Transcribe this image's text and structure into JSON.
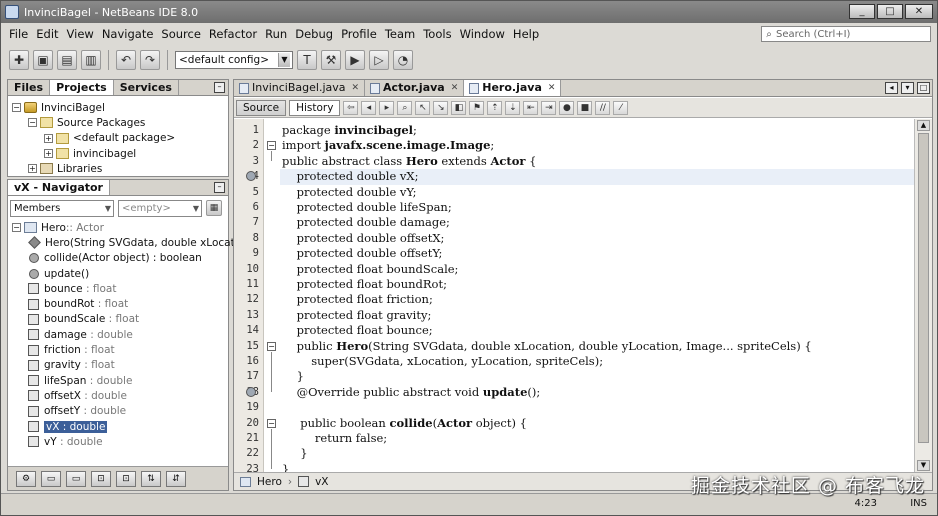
{
  "window": {
    "title": "InvinciBagel - NetBeans IDE 8.0"
  },
  "menu": [
    "File",
    "Edit",
    "View",
    "Navigate",
    "Source",
    "Refactor",
    "Run",
    "Debug",
    "Profile",
    "Team",
    "Tools",
    "Window",
    "Help"
  ],
  "search": {
    "placeholder": "Search (Ctrl+I)"
  },
  "toolbar": {
    "config": "<default config>"
  },
  "projects_panel": {
    "tabs": [
      "Files",
      "Projects",
      "Services"
    ],
    "tree": {
      "project": "InvinciBagel",
      "source_packages": "Source Packages",
      "default_package": "<default package>",
      "package": "invincibagel",
      "libraries": "Libraries"
    }
  },
  "navigator": {
    "title": "vX - Navigator",
    "filter": "Members",
    "empty": "<empty>",
    "class_name": "Hero",
    "class_parent": " :: Actor",
    "members": [
      {
        "name": "Hero",
        "detail": "(String SVGdata, double xLocation,",
        "kind": "constructor"
      },
      {
        "name": "collide",
        "detail": "(Actor object) : boolean",
        "kind": "method"
      },
      {
        "name": "update",
        "detail": "()",
        "kind": "method"
      },
      {
        "name": "bounce",
        "detail": " : float",
        "kind": "field"
      },
      {
        "name": "boundRot",
        "detail": " : float",
        "kind": "field"
      },
      {
        "name": "boundScale",
        "detail": " : float",
        "kind": "field"
      },
      {
        "name": "damage",
        "detail": " : double",
        "kind": "field"
      },
      {
        "name": "friction",
        "detail": " : float",
        "kind": "field"
      },
      {
        "name": "gravity",
        "detail": " : float",
        "kind": "field"
      },
      {
        "name": "lifeSpan",
        "detail": " : double",
        "kind": "field"
      },
      {
        "name": "offsetX",
        "detail": " : double",
        "kind": "field"
      },
      {
        "name": "offsetY",
        "detail": " : double",
        "kind": "field"
      },
      {
        "name": "vX",
        "detail": " : double",
        "kind": "field",
        "selected": true
      },
      {
        "name": "vY",
        "detail": " : double",
        "kind": "field"
      }
    ]
  },
  "editor": {
    "tabs": [
      "InvinciBagel.java",
      "Actor.java",
      "Hero.java"
    ],
    "active_tab": "Hero.java",
    "source_label": "Source",
    "history_label": "History",
    "lines": [
      "package invincibagel;",
      "import javafx.scene.image.Image;",
      "public abstract class Hero extends Actor {",
      "    protected double vX;",
      "    protected double vY;",
      "    protected double lifeSpan;",
      "    protected double damage;",
      "    protected double offsetX;",
      "    protected double offsetY;",
      "    protected float boundScale;",
      "    protected float boundRot;",
      "    protected float friction;",
      "    protected float gravity;",
      "    protected float bounce;",
      "    public Hero(String SVGdata, double xLocation, double yLocation, Image... spriteCels) {",
      "        super(SVGdata, xLocation, yLocation, spriteCels);",
      "    }",
      "    @Override public abstract void update();",
      "",
      "     public boolean collide(Actor object) {",
      "         return false;",
      "     }",
      "}"
    ],
    "breadcrumbs": [
      "Hero",
      "vX"
    ]
  },
  "status": {
    "position": "4:23",
    "mode": "INS"
  },
  "watermark": "掘金技术社区 @ 布客飞龙"
}
